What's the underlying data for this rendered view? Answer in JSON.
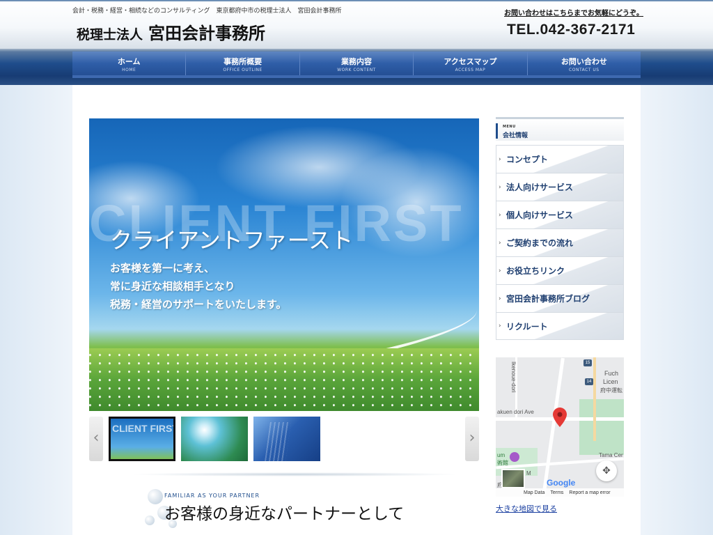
{
  "header": {
    "tagline": "会計・税務・経営・相続などのコンサルティング　東京都府中市の税理士法人　宮田会計事務所",
    "logo_small": "税理士法人",
    "logo_big": "宮田会計事務所",
    "contact_note": "お問い合わせはこちらまでお気軽にどうぞ。",
    "tel": "TEL.042-367-2171"
  },
  "nav": {
    "items": [
      {
        "jp": "ホーム",
        "en": "HOME"
      },
      {
        "jp": "事務所概要",
        "en": "OFFICE OUTLINE"
      },
      {
        "jp": "業務内容",
        "en": "WORK CONTENT"
      },
      {
        "jp": "アクセスマップ",
        "en": "ACCESS MAP"
      },
      {
        "jp": "お問い合わせ",
        "en": "CONTACT US"
      }
    ]
  },
  "slider": {
    "bg_text": "CLIENT FIRST",
    "title": "クライアントファースト",
    "lines": [
      "お客様を第一に考え、",
      "常に身近な相談相手となり",
      "税務・経営のサポートをいたします。"
    ],
    "thumb1_text": "CLIENT FIRST",
    "prev_icon": "‹",
    "next_icon": "›"
  },
  "partner": {
    "en": "FAMILIAR AS YOUR PARTNER",
    "jp": "お客様の身近なパートナーとして"
  },
  "sidebar": {
    "head_en": "MENU",
    "head_jp": "会社情報",
    "items": [
      {
        "label": "コンセプト"
      },
      {
        "label": "法人向けサービス"
      },
      {
        "label": "個人向けサービス"
      },
      {
        "label": "ご契約までの流れ"
      },
      {
        "label": "お役立ちリンク"
      },
      {
        "label": "宮田会計事務所ブログ"
      },
      {
        "label": "リクルート"
      }
    ]
  },
  "map": {
    "labels": {
      "ikenoue": "Ikenoue-dori",
      "fuchu": "Fuch",
      "licen": "Licen",
      "fuchu_jp": "府中運転",
      "gakuen": "akuen dori Ave",
      "tama": "Tama Cer",
      "um": "um",
      "museum_jp": "術館",
      "route15": "15",
      "route14": "14",
      "fuchu_small": "府中",
      "m": "M"
    },
    "google": "Google",
    "attrib": [
      "Map Data",
      "Terms",
      "Report a map error"
    ],
    "big_map_link": "大きな地図で見る"
  }
}
